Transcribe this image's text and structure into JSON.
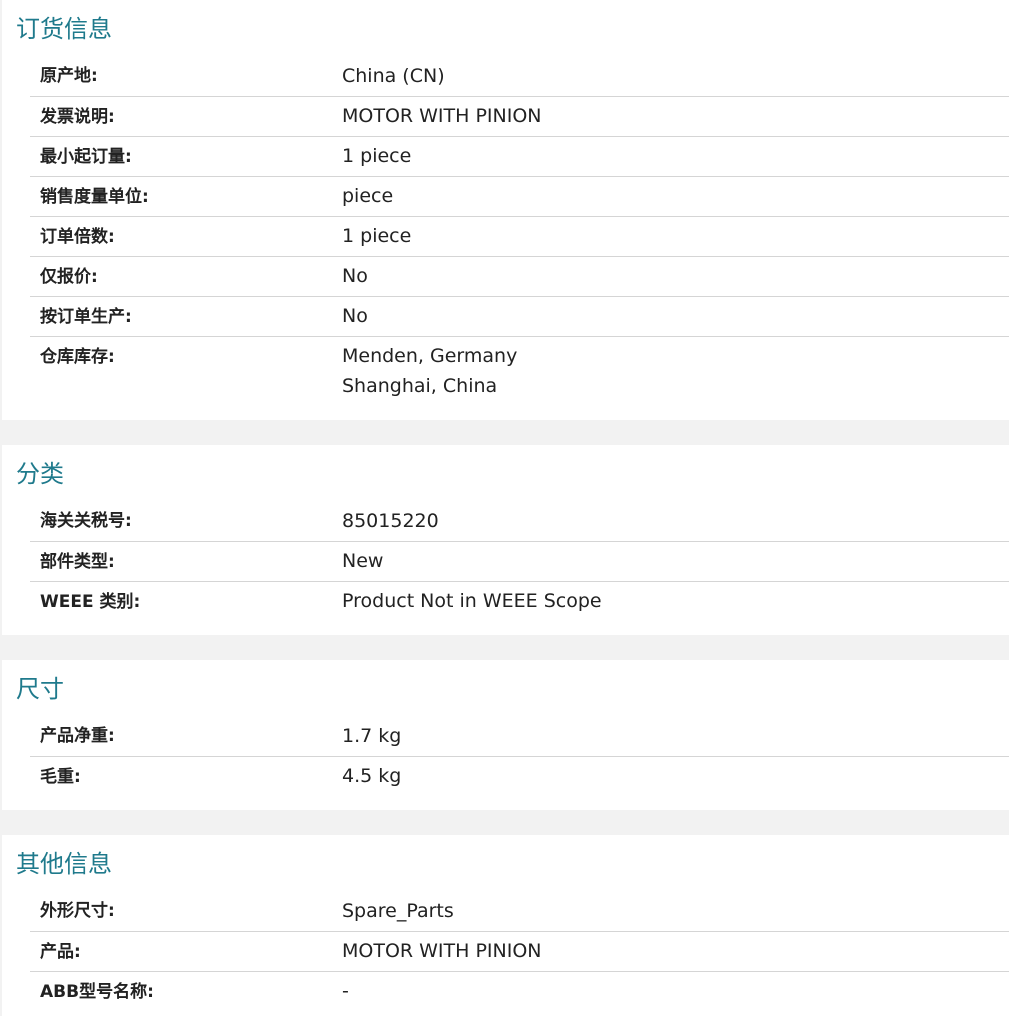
{
  "sections": [
    {
      "title": "订货信息",
      "rows": [
        {
          "label": "原产地:",
          "value": "China (CN)"
        },
        {
          "label": "发票说明:",
          "value": "MOTOR WITH PINION"
        },
        {
          "label": "最小起订量:",
          "value": "1 piece"
        },
        {
          "label": "销售度量单位:",
          "value": "piece"
        },
        {
          "label": "订单倍数:",
          "value": "1 piece"
        },
        {
          "label": "仅报价:",
          "value": "No"
        },
        {
          "label": "按订单生产:",
          "value": "No"
        },
        {
          "label": "仓库库存:",
          "value": "Menden, Germany",
          "value2": "Shanghai, China"
        }
      ]
    },
    {
      "title": "分类",
      "rows": [
        {
          "label": "海关关税号:",
          "value": "85015220"
        },
        {
          "label": "部件类型:",
          "value": "New"
        },
        {
          "label": "WEEE 类别:",
          "value": "Product Not in WEEE Scope"
        }
      ]
    },
    {
      "title": "尺寸",
      "rows": [
        {
          "label": "产品净重:",
          "value": "1.7 kg"
        },
        {
          "label": "毛重:",
          "value": "4.5 kg"
        }
      ]
    },
    {
      "title": "其他信息",
      "rows": [
        {
          "label": "外形尺寸:",
          "value": "Spare_Parts"
        },
        {
          "label": "产品:",
          "value": "MOTOR WITH PINION"
        },
        {
          "label": "ABB型号名称:",
          "value": "-"
        }
      ]
    }
  ]
}
